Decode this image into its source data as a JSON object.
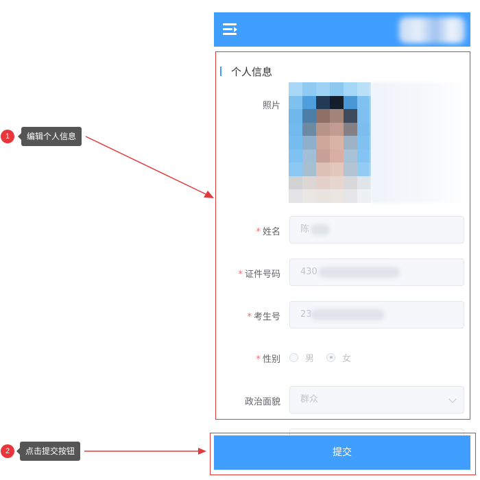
{
  "form": {
    "section_title": "个人信息",
    "fields": {
      "photo_label": "照片",
      "name_label": "姓名",
      "name_value": "陈",
      "id_label": "证件号码",
      "id_value": "430",
      "exam_label": "考生号",
      "exam_value": "23",
      "gender_label": "性别",
      "gender_options": [
        "男",
        "女"
      ],
      "gender_selected": "女",
      "politics_label": "政治面貌",
      "politics_value": "群众"
    },
    "required_marker": "*",
    "submit_label": "提交"
  },
  "annotations": [
    {
      "number": "1",
      "text": "编辑个人信息"
    },
    {
      "number": "2",
      "text": "点击提交按钮"
    }
  ],
  "colors": {
    "primary": "#409eff",
    "annotation_red": "#e03b3b",
    "required": "#f56c6c"
  },
  "icons": {
    "menu": "menu-fold-icon",
    "select": "chevron-down-icon"
  }
}
